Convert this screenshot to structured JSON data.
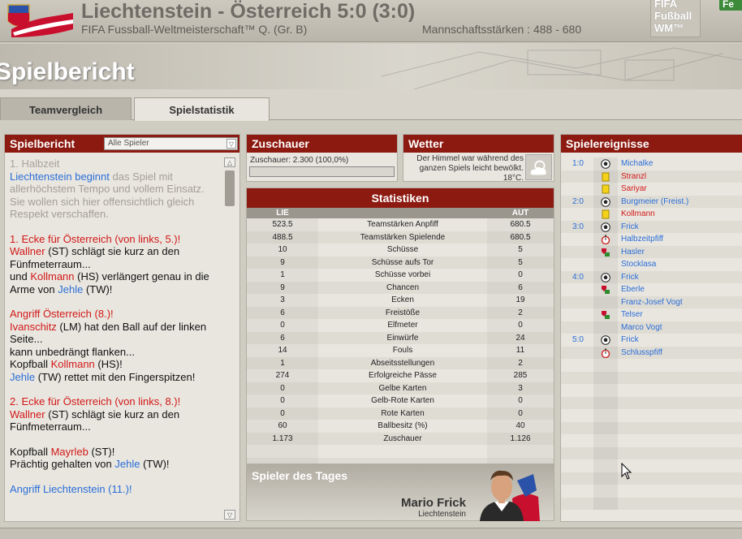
{
  "header": {
    "title": "Liechtenstein - Österreich 5:0 (3:0)",
    "subtitle": "FIFA Fussball-Weltmeisterschaft™ Q. (Gr. B)",
    "strength": "Mannschaftsstärken : 488 - 680",
    "logo_text": "FIFA Fußball WM™",
    "corner_button": "Fe"
  },
  "page_title": "Spielbericht",
  "tabs": [
    {
      "label": "Teamvergleich"
    },
    {
      "label": "Spielstatistik"
    }
  ],
  "spielbericht": {
    "title": "Spielbericht",
    "filter": "Alle Spieler",
    "report": [
      [
        {
          "t": "1. Halbzeit",
          "c": "g"
        },
        {
          "br": 1
        },
        {
          "t": "Liechtenstein beginnt",
          "c": "b"
        },
        {
          "t": " das Spiel mit allerhöchstem Tempo und vollem Einsatz. Sie wollen sich hier offensichtlich gleich Respekt verschaffen.",
          "c": "gr"
        }
      ],
      [
        {
          "t": "1. Ecke für Österreich (von links, 5.)!",
          "c": "r"
        },
        {
          "br": 1
        },
        {
          "t": "Wallner",
          "c": "r"
        },
        {
          "t": " (ST) schlägt sie kurz an den Fünfmeterraum..."
        },
        {
          "br": 1
        },
        {
          "t": "und "
        },
        {
          "t": "Kollmann",
          "c": "r"
        },
        {
          "t": " (HS) verlängert genau in die Arme von "
        },
        {
          "t": "Jehle",
          "c": "b"
        },
        {
          "t": " (TW)!"
        }
      ],
      [
        {
          "t": "Angriff Österreich (8.)!",
          "c": "r"
        },
        {
          "br": 1
        },
        {
          "t": "Ivanschitz",
          "c": "r"
        },
        {
          "t": " (LM) hat den Ball auf der linken Seite..."
        },
        {
          "br": 1
        },
        {
          "t": "kann unbedrängt flanken..."
        },
        {
          "br": 1
        },
        {
          "t": "Kopfball "
        },
        {
          "t": "Kollmann",
          "c": "r"
        },
        {
          "t": " (HS)!"
        },
        {
          "br": 1
        },
        {
          "t": "Jehle",
          "c": "b"
        },
        {
          "t": " (TW) rettet mit den Fingerspitzen!"
        }
      ],
      [
        {
          "t": "2. Ecke für Österreich (von links, 8.)!",
          "c": "r"
        },
        {
          "br": 1
        },
        {
          "t": "Wallner",
          "c": "r"
        },
        {
          "t": " (ST) schlägt sie kurz an den Fünfmeterraum..."
        }
      ],
      [
        {
          "t": "Kopfball "
        },
        {
          "t": "Mayrleb",
          "c": "r"
        },
        {
          "t": " (ST)!"
        },
        {
          "br": 1
        },
        {
          "t": "Prächtig gehalten von "
        },
        {
          "t": "Jehle",
          "c": "b"
        },
        {
          "t": " (TW)!"
        }
      ],
      [
        {
          "t": "Angriff Liechtenstein (11.)!",
          "c": "b"
        }
      ]
    ]
  },
  "zuschauer": {
    "title": "Zuschauer",
    "text": "Zuschauer: 2.300 (100,0%)",
    "fill": 0
  },
  "wetter": {
    "title": "Wetter",
    "text": "Der Himmel war während des ganzen Spiels leicht bewölkt. 18°C.",
    "icon": "partly-cloudy-icon"
  },
  "statistiken": {
    "title": "Statistiken",
    "home": "LIE",
    "away": "AUT",
    "rows": [
      [
        "523.5",
        "Teamstärken Anpfiff",
        "680.5"
      ],
      [
        "488.5",
        "Teamstärken Spielende",
        "680.5"
      ],
      [
        "10",
        "Schüsse",
        "5"
      ],
      [
        "9",
        "Schüsse aufs Tor",
        "5"
      ],
      [
        "1",
        "Schüsse vorbei",
        "0"
      ],
      [
        "9",
        "Chancen",
        "6"
      ],
      [
        "3",
        "Ecken",
        "19"
      ],
      [
        "6",
        "Freistöße",
        "2"
      ],
      [
        "0",
        "Elfmeter",
        "0"
      ],
      [
        "6",
        "Einwürfe",
        "24"
      ],
      [
        "14",
        "Fouls",
        "11"
      ],
      [
        "1",
        "Abseitsstellungen",
        "2"
      ],
      [
        "274",
        "Erfolgreiche Pässe",
        "285"
      ],
      [
        "0",
        "Gelbe Karten",
        "3"
      ],
      [
        "0",
        "Gelb-Rote Karten",
        "0"
      ],
      [
        "0",
        "Rote Karten",
        "0"
      ],
      [
        "60",
        "Ballbesitz (%)",
        "40"
      ],
      [
        "1.173",
        "Zuschauer",
        "1.126"
      ]
    ]
  },
  "spieler_des_tages": {
    "title": "Spieler des Tages",
    "name": "Mario Frick",
    "team": "Liechtenstein"
  },
  "ereignisse": {
    "title": "Spielereignisse",
    "rows": [
      {
        "score": "1:0",
        "icon": "ball",
        "name": "Michalke",
        "color": "#2a6ed8"
      },
      {
        "score": "",
        "icon": "yellow",
        "name": "Stranzl",
        "color": "#d21818"
      },
      {
        "score": "",
        "icon": "yellow",
        "name": "Sariyar",
        "color": "#d21818"
      },
      {
        "score": "2:0",
        "icon": "ball",
        "name": "Burgmeier (Freist.)",
        "color": "#2a6ed8"
      },
      {
        "score": "",
        "icon": "yellow",
        "name": "Kollmann",
        "color": "#d21818"
      },
      {
        "score": "3:0",
        "icon": "ball",
        "name": "Frick",
        "color": "#2a6ed8"
      },
      {
        "score": "",
        "icon": "whistle",
        "name": "Halbzeitpfiff",
        "color": "#2a6ed8"
      },
      {
        "score": "",
        "icon": "sub",
        "name": "Hasler",
        "color": "#2a6ed8"
      },
      {
        "score": "",
        "icon": "",
        "name": "Stocklasa",
        "color": "#2a6ed8"
      },
      {
        "score": "4:0",
        "icon": "ball",
        "name": "Frick",
        "color": "#2a6ed8"
      },
      {
        "score": "",
        "icon": "sub",
        "name": "Eberle",
        "color": "#2a6ed8"
      },
      {
        "score": "",
        "icon": "",
        "name": "Franz-Josef Vogt",
        "color": "#2a6ed8"
      },
      {
        "score": "",
        "icon": "sub",
        "name": "Telser",
        "color": "#2a6ed8"
      },
      {
        "score": "",
        "icon": "",
        "name": "Marco Vogt",
        "color": "#2a6ed8"
      },
      {
        "score": "5:0",
        "icon": "ball",
        "name": "Frick",
        "color": "#2a6ed8"
      },
      {
        "score": "",
        "icon": "whistle",
        "name": "Schlusspfiff",
        "color": "#2a6ed8"
      }
    ]
  }
}
